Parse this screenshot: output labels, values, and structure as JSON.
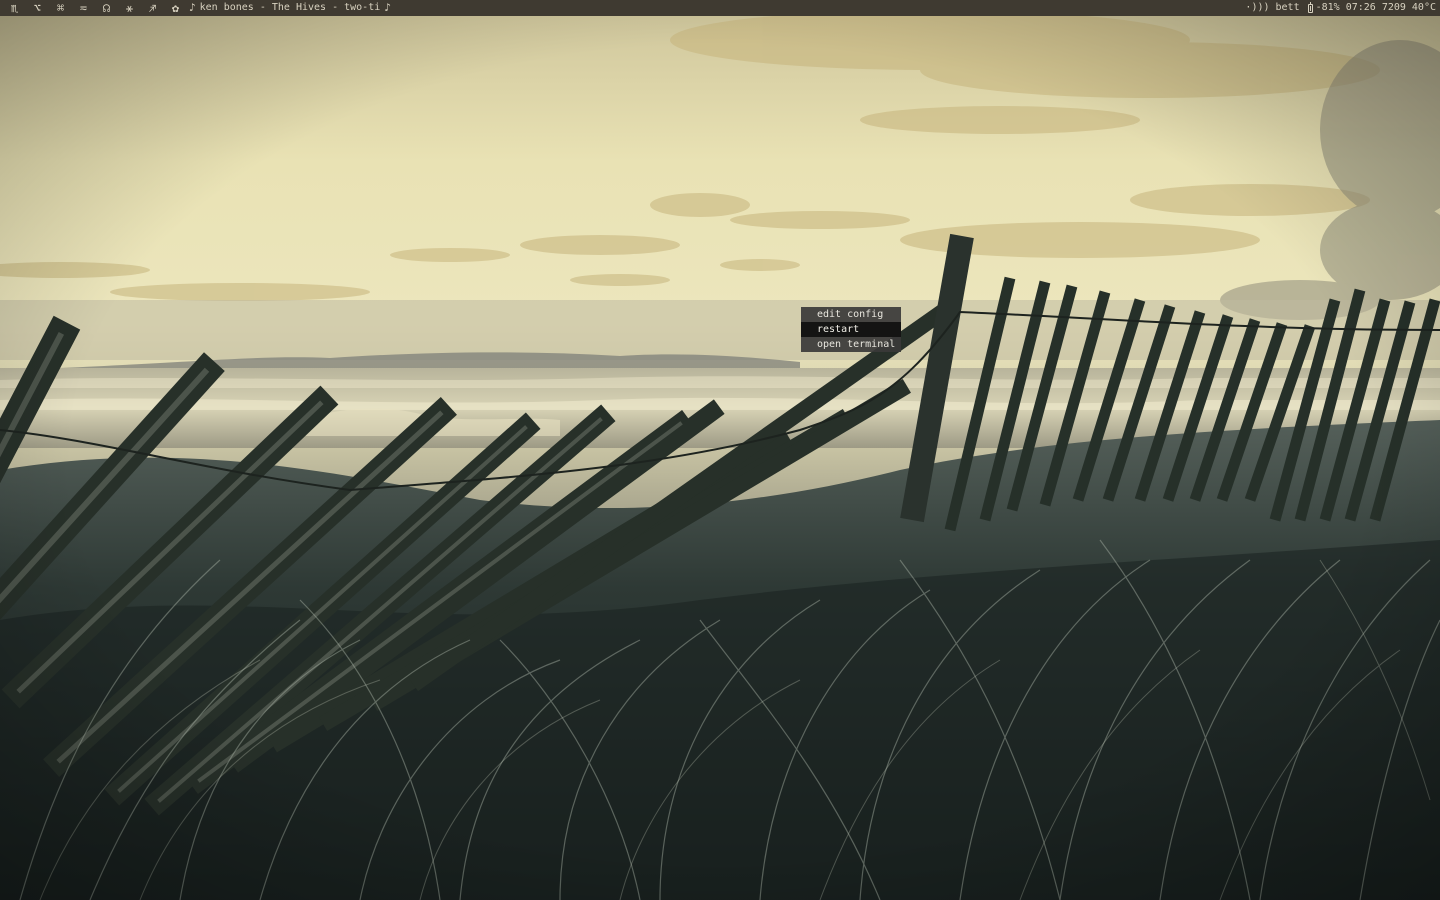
{
  "topbar": {
    "workspaces": [
      {
        "glyph": "♏",
        "icon": "scorpio-icon",
        "active": true
      },
      {
        "glyph": "⌥",
        "icon": "option-key-icon",
        "active": false
      },
      {
        "glyph": "⌘",
        "icon": "command-key-icon",
        "active": false
      },
      {
        "glyph": "≂",
        "icon": "wave-icon",
        "active": false
      },
      {
        "glyph": "☊",
        "icon": "headphones-icon",
        "active": false
      },
      {
        "glyph": "⚹",
        "icon": "sextile-icon",
        "active": false
      },
      {
        "glyph": "♐",
        "icon": "sagittarius-icon",
        "active": false
      },
      {
        "glyph": "✿",
        "icon": "flower-icon",
        "active": false
      }
    ],
    "now_playing": {
      "note_icon": "♪",
      "text": "ken bones - The Hives - two-ti",
      "note_icon_end": "♪"
    },
    "status": {
      "volume_icon": "·)))",
      "user": "bett",
      "battery": "-81%",
      "time": "07:26",
      "mem": "7209",
      "temperature": "40°C"
    }
  },
  "menu": {
    "items": [
      {
        "label": "edit config",
        "selected": false
      },
      {
        "label": "restart",
        "selected": true
      },
      {
        "label": "open terminal",
        "selected": false
      }
    ]
  },
  "colors": {
    "bar_bg": "#3f3a31",
    "bar_fg": "#d8d2c0",
    "menu_bg": "#3a3a38",
    "menu_selected": "#141413"
  }
}
